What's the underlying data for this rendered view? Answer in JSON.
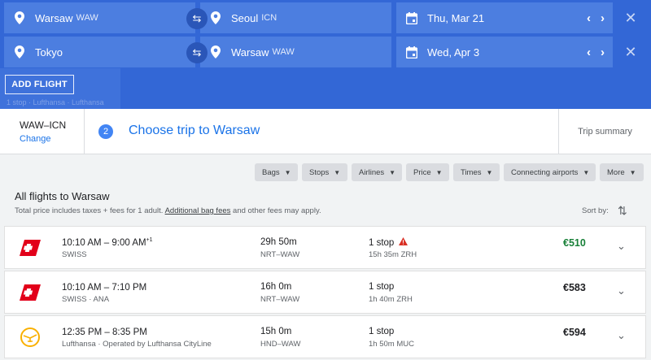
{
  "search": {
    "legs": [
      {
        "origin": "Warsaw",
        "origin_code": "WAW",
        "destination": "Seoul",
        "destination_code": "ICN",
        "date": "Thu, Mar 21"
      },
      {
        "origin": "Tokyo",
        "origin_code": "",
        "destination": "Warsaw",
        "destination_code": "WAW",
        "date": "Wed, Apr 3"
      }
    ],
    "add_flight_label": "ADD FLIGHT",
    "ghost_text": "1 stop · Lufthansa · Lufthansa"
  },
  "steps": {
    "previous_route": "WAW–ICN",
    "change_label": "Change",
    "current_number": "2",
    "current_title": "Choose trip to Warsaw",
    "summary_label": "Trip summary"
  },
  "filters": [
    "Bags",
    "Stops",
    "Airlines",
    "Price",
    "Times",
    "Connecting airports",
    "More"
  ],
  "list": {
    "title": "All flights to Warsaw",
    "subtitle_pre": "Total price includes taxes + fees for 1 adult. ",
    "subtitle_link": "Additional bag fees",
    "subtitle_post": " and other fees may apply.",
    "sort_label": "Sort by:"
  },
  "flights": [
    {
      "times": "10:10 AM – 9:00 AM",
      "day_offset": "+1",
      "airline": "SWISS",
      "duration": "29h 50m",
      "route": "NRT–WAW",
      "stops": "1 stop",
      "layover": "15h 35m ZRH",
      "price": "€510",
      "warning": true,
      "logo": "swiss"
    },
    {
      "times": "10:10 AM – 7:10 PM",
      "day_offset": "",
      "airline": "SWISS · ANA",
      "duration": "16h 0m",
      "route": "NRT–WAW",
      "stops": "1 stop",
      "layover": "1h 40m ZRH",
      "price": "€583",
      "warning": false,
      "logo": "swiss"
    },
    {
      "times": "12:35 PM – 8:35 PM",
      "day_offset": "",
      "airline": "Lufthansa · Operated by Lufthansa CityLine",
      "duration": "15h 0m",
      "route": "HND–WAW",
      "stops": "1 stop",
      "layover": "1h 50m MUC",
      "price": "€594",
      "warning": false,
      "logo": "lufthansa"
    }
  ],
  "colors": {
    "header_bg": "#3367d6",
    "field_bg": "#4c7ee0",
    "accent_blue": "#1a73e8",
    "best_price_green": "#188038",
    "swiss_red": "#e2001a",
    "lufthansa_yellow": "#f9b000",
    "warning_red": "#d93025"
  }
}
